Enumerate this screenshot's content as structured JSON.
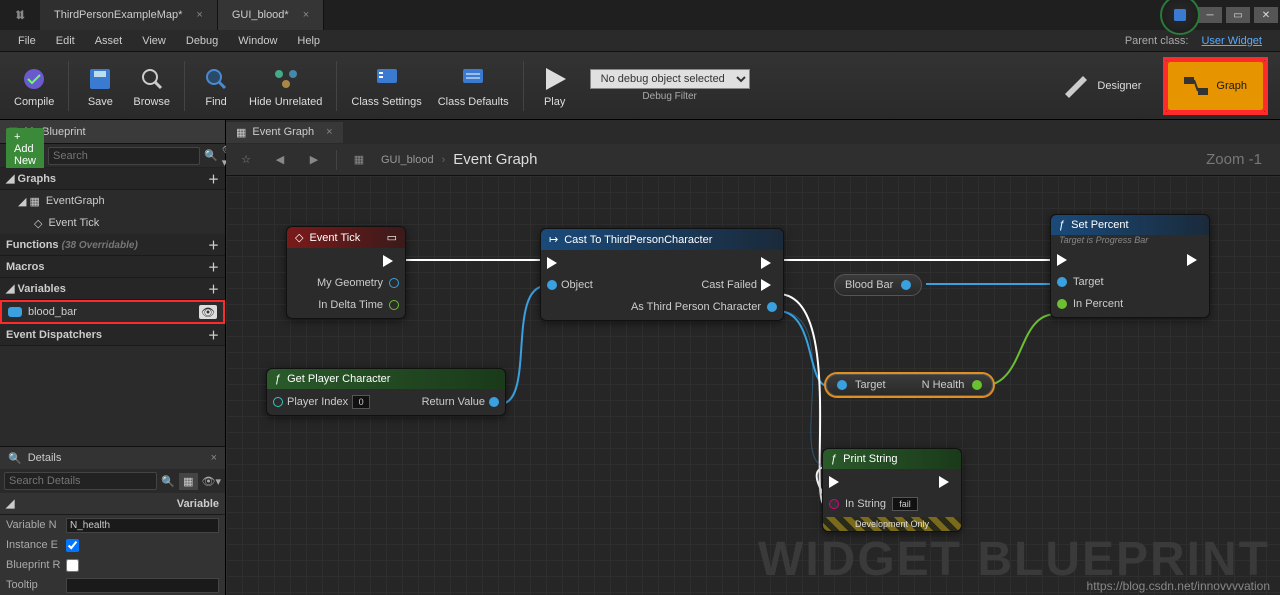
{
  "window": {
    "tabs": [
      {
        "label": "ThirdPersonExampleMap*",
        "active": false
      },
      {
        "label": "GUI_blood*",
        "active": true
      }
    ]
  },
  "menu": [
    "File",
    "Edit",
    "Asset",
    "View",
    "Debug",
    "Window",
    "Help"
  ],
  "parent_class": {
    "prefix": "Parent class:",
    "value": "User Widget"
  },
  "toolbar": {
    "compile": "Compile",
    "save": "Save",
    "browse": "Browse",
    "find": "Find",
    "hide_unrelated": "Hide Unrelated",
    "class_settings": "Class Settings",
    "class_defaults": "Class Defaults",
    "play": "Play",
    "debug_select": "No debug object selected",
    "debug_filter": "Debug Filter",
    "designer": "Designer",
    "graph": "Graph"
  },
  "left": {
    "panel_title": "My Blueprint",
    "add_new": "+ Add New",
    "search_placeholder": "Search",
    "categories": {
      "graphs": "Graphs",
      "eventgraph": "EventGraph",
      "event_tick": "Event Tick",
      "functions": "Functions",
      "functions_hint": "(38 Overridable)",
      "macros": "Macros",
      "variables": "Variables",
      "blood_bar": "blood_bar",
      "event_dispatchers": "Event Dispatchers"
    },
    "details_title": "Details",
    "details_search": "Search Details",
    "variable_section": "Variable",
    "rows": {
      "variable_name_label": "Variable N",
      "variable_name_value": "N_health",
      "instance_editable": "Instance E",
      "blueprint_readonly": "Blueprint R",
      "tooltip": "Tooltip"
    }
  },
  "graph": {
    "tab": "Event Graph",
    "breadcrumb1": "GUI_blood",
    "breadcrumb2": "Event Graph",
    "zoom": "Zoom -1"
  },
  "nodes": {
    "event_tick": {
      "title": "Event Tick",
      "p1": "My Geometry",
      "p2": "In Delta Time"
    },
    "get_player": {
      "title": "Get Player Character",
      "p_in": "Player Index",
      "p_in_val": "0",
      "p_out": "Return Value"
    },
    "cast": {
      "title": "Cast To ThirdPersonCharacter",
      "obj": "Object",
      "fail": "Cast Failed",
      "as": "As Third Person Character"
    },
    "blood_bar": {
      "title": "Blood Bar"
    },
    "target_health": {
      "target": "Target",
      "nhealth": "N Health"
    },
    "set_percent": {
      "title": "Set Percent",
      "sub": "Target is Progress Bar",
      "target": "Target",
      "percent": "In Percent"
    },
    "print_string": {
      "title": "Print String",
      "instr": "In String",
      "instr_val": "fail",
      "devonly": "Development Only"
    }
  },
  "watermark": "WIDGET BLUEPRINT",
  "blog": "https://blog.csdn.net/innovvvvation"
}
